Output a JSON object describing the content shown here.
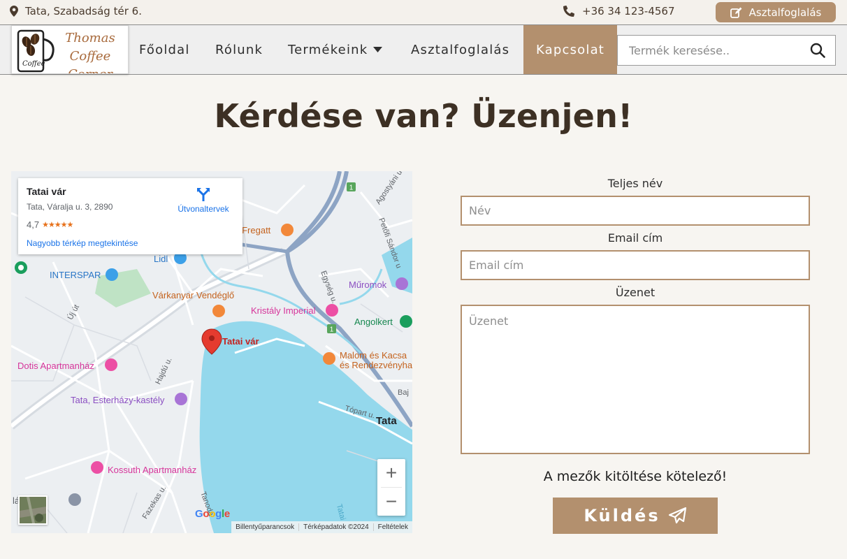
{
  "topbar": {
    "address": "Tata, Szabadság tér 6.",
    "phone": "+36 34 123-4567",
    "reserve_button": "Asztalfoglalás"
  },
  "logo": {
    "line1": "Thomas Coffee",
    "line2": "Corner",
    "mug_text": "Coffee"
  },
  "nav": {
    "items": [
      {
        "label": "Főoldal"
      },
      {
        "label": "Rólunk"
      },
      {
        "label": "Termékeink"
      },
      {
        "label": "Asztalfoglalás"
      },
      {
        "label": "Kapcsolat",
        "active": true
      }
    ],
    "search_placeholder": "Termék keresése.."
  },
  "page": {
    "title": "Kérdése van? Üzenjen!"
  },
  "map": {
    "card": {
      "title": "Tatai vár",
      "address": "Tata, Váralja u. 3, 2890",
      "rating": "4,7",
      "rating_stars": "★★★★★",
      "directions": "Útvonaltervek",
      "larger_map": "Nagyobb térkép megtekintése"
    },
    "labels": {
      "fregatt": "z Fregatt",
      "lidl": "Lidl",
      "interspar": "INTERSPAR",
      "varkanyar": "Várkanyar Vendéglő",
      "kristaly": "Kristály Imperial",
      "muromok": "Műromok",
      "angolkert": "Angolkert",
      "tatai_var": "Tatai vár",
      "malom1": "Malom és Kacsa",
      "malom2": "és Rendezvényha",
      "dotis": "Dotis Apartmanház",
      "esterhazy": "Tata, Esterházy-kastély",
      "kossuth": "Kossuth Apartmanház",
      "tata": "Tata",
      "ujut": "Új út",
      "hajdu": "Hajdú u.",
      "agostyani": "Agostyáni u",
      "petofi": "Petőfi Sándor u",
      "egyseg": "Egység u.",
      "topart": "Tópart u.",
      "baj": "Baj",
      "fazekas": "Fazekas u.",
      "tanoda": "Tanoda",
      "tatai_to": "Tatai",
      "iskola": "lá   kola",
      "road_badge": "1"
    },
    "zoom_in": "+",
    "zoom_out": "−",
    "google": [
      "G",
      "o",
      "o",
      "g",
      "l",
      "e"
    ],
    "google_colors": [
      "#4285f4",
      "#ea4335",
      "#fbbc05",
      "#4285f4",
      "#34a853",
      "#ea4335"
    ],
    "attribution": [
      "Billentyűparancsok",
      "Térképadatok ©2024",
      "Feltételek"
    ]
  },
  "form": {
    "name_label": "Teljes név",
    "name_placeholder": "Név",
    "email_label": "Email cím",
    "email_placeholder": "Email cím",
    "message_label": "Üzenet",
    "message_placeholder": "Üzenet",
    "required_note": "A mezők kitöltése kötelező!",
    "submit": "Küldés"
  },
  "colors": {
    "accent": "#b3906e",
    "heading": "#3d3024",
    "background": "#f7f5f1",
    "water": "#94d8ec"
  }
}
